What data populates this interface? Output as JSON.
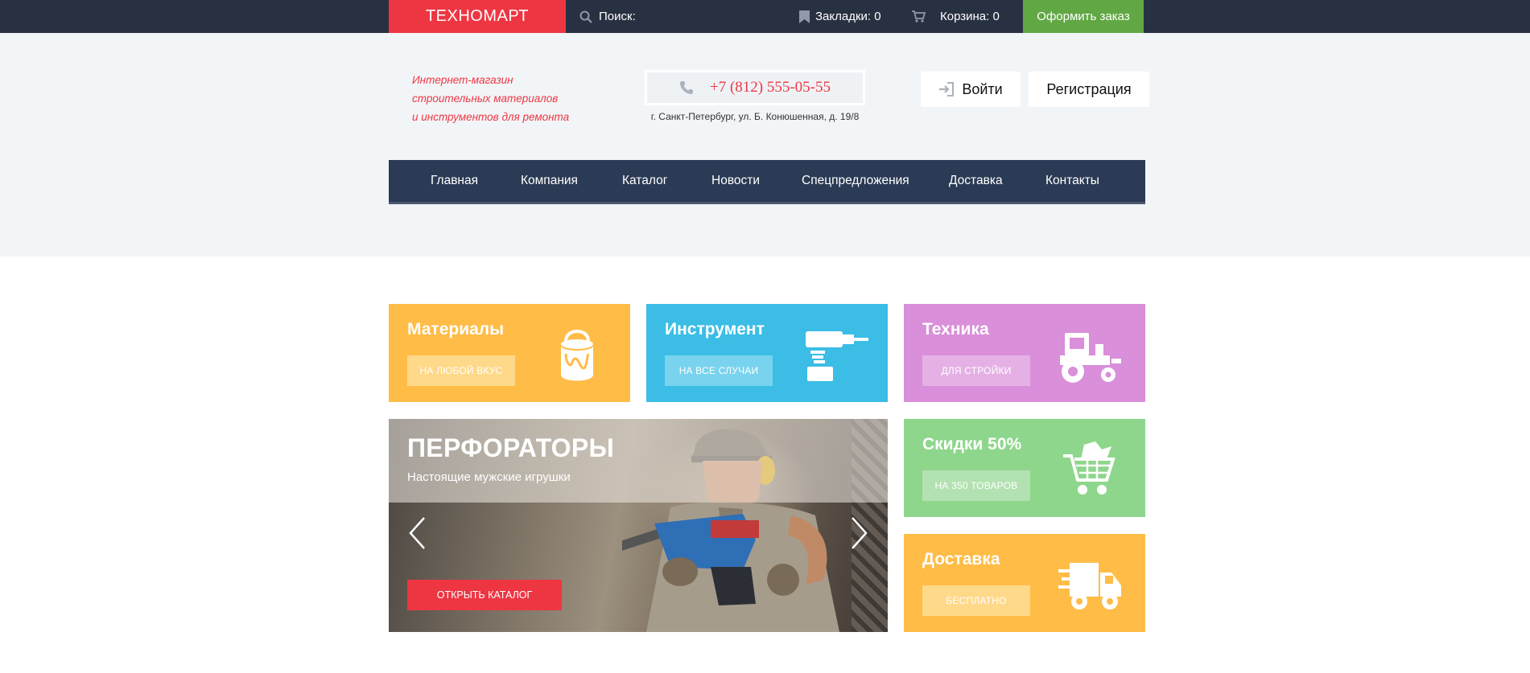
{
  "topbar": {
    "logo": "ТЕХНОМАРТ",
    "search_label": "Поиск:",
    "bookmarks_label": "Закладки: 0",
    "cart_label": "Корзина: 0",
    "order_button": "Оформить заказ"
  },
  "header": {
    "tagline": [
      "Интернет-магазин",
      "строительных материалов",
      "и инструментов для ремонта"
    ],
    "phone": "+7 (812) 555-05-55",
    "address": "г. Санкт-Петербург, ул. Б. Конюшенная, д. 19/8",
    "login": "Войти",
    "register": "Регистрация"
  },
  "nav": {
    "items": [
      {
        "label": "Главная"
      },
      {
        "label": "Компания"
      },
      {
        "label": "Каталог"
      },
      {
        "label": "Новости"
      },
      {
        "label": "Спецпредложения"
      },
      {
        "label": "Доставка"
      },
      {
        "label": "Контакты"
      }
    ]
  },
  "tiles": {
    "materials": {
      "title": "Материалы",
      "button": "НА ЛЮБОЙ ВКУС",
      "icon": "paint-bucket-icon"
    },
    "tools": {
      "title": "Инструмент",
      "button": "НА ВСЕ СЛУЧАИ",
      "icon": "drill-icon"
    },
    "tech": {
      "title": "Техника",
      "button": "ДЛЯ СТРОЙКИ",
      "icon": "tractor-icon"
    },
    "sale": {
      "title": "Скидки 50%",
      "button": "НА 350 ТОВАРОВ",
      "icon": "shopping-cart-icon"
    },
    "delivery": {
      "title": "Доставка",
      "button": "БЕСПЛАТНО",
      "icon": "delivery-truck-icon"
    }
  },
  "slider": {
    "title": "ПЕРФОРАТОРЫ",
    "subtitle": "Настоящие мужские игрушки",
    "button": "ОТКРЫТЬ КАТАЛОГ"
  },
  "colors": {
    "brand_red": "#ee3643",
    "topbar_bg": "#283141",
    "order_green": "#61a845",
    "nav_bg": "#2b3b55",
    "tile_orange": "#ffbc47",
    "tile_blue": "#3bbde6",
    "tile_purple": "#d98fd9",
    "tile_green": "#8fd68d"
  }
}
